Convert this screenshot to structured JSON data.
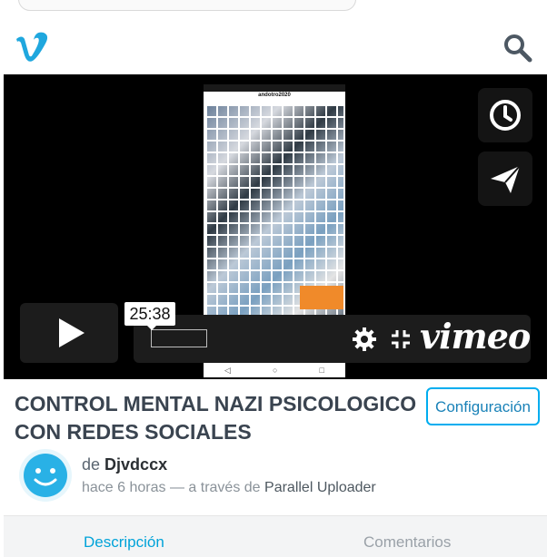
{
  "header": {
    "logo_letter": "v",
    "brand_color": "#00adef"
  },
  "player": {
    "timecode": "25:38",
    "wordmark": "vimeo",
    "phone_title": "andotro2020"
  },
  "video": {
    "title": "CONTROL MENTAL NAZI PSICOLOGICO CON REDES SOCIALES",
    "configure_label": "Configuración",
    "by_prefix": "de",
    "author": "Djvdccx",
    "time_ago": "hace 6 horas — a través de",
    "uploader_app": "Parallel Uploader"
  },
  "tabs": {
    "description": "Descripción",
    "comments": "Comentarios"
  },
  "icons": {
    "search": "search-icon",
    "watch_later": "clock-icon",
    "share": "paper-plane-icon",
    "play": "play-icon",
    "settings": "gear-icon",
    "fullscreen": "fullscreen-icon",
    "avatar": "smiley-avatar-icon"
  }
}
